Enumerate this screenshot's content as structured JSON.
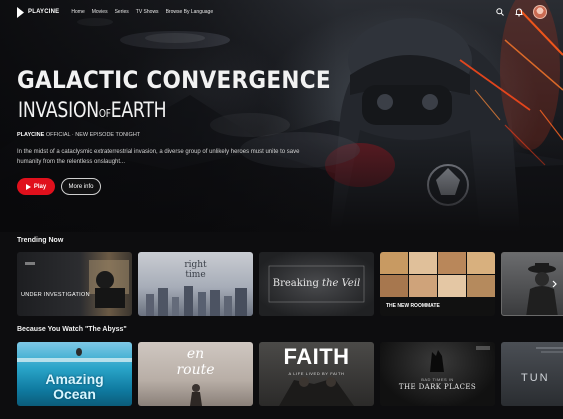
{
  "nav": {
    "logo": "PLAYCINE",
    "links": [
      "Home",
      "Movies",
      "Series",
      "TV Shows",
      "Browse By Language"
    ],
    "icons": [
      "search-icon",
      "bell-icon"
    ]
  },
  "hero": {
    "title_line1": "GALACTIC CONVERGENCE",
    "title_line2a": "INVASION",
    "title_line2b": "OF",
    "title_line2c": "EARTH",
    "meta_brand": "PLAYCINE",
    "meta_rest": " OFFICIAL · NEW EPISODE TONIGHT",
    "description": "In the midst of a cataclysmic extraterrestrial invasion, a diverse group of unlikely heroes must unite to save humanity from the relentless onslaught...",
    "play_label": "Play",
    "info_label": "More info"
  },
  "rows": [
    {
      "title": "Trending Now",
      "cards": [
        {
          "label": "UNDER INVESTIGATION"
        },
        {
          "label_a": "right",
          "label_b": "time"
        },
        {
          "label_a": "Breaking",
          "label_b": "the Veil"
        },
        {
          "label": "THE NEW ROOMMATE"
        },
        {
          "label": ""
        }
      ]
    },
    {
      "title": "Because You Watch \"The Abyss\"",
      "cards": [
        {
          "label_a": "Amazing",
          "label_b": "Ocean"
        },
        {
          "label_a": "en",
          "label_b": "route"
        },
        {
          "label": "FAITH",
          "sub": "A LIFE LIVED BY FAITH"
        },
        {
          "label_top": "BAD TIMES IN",
          "label": "THE DARK PLACES"
        },
        {
          "label": "TUN"
        }
      ]
    }
  ],
  "colors": {
    "accent": "#e0101c",
    "background": "#0d0d0f"
  }
}
